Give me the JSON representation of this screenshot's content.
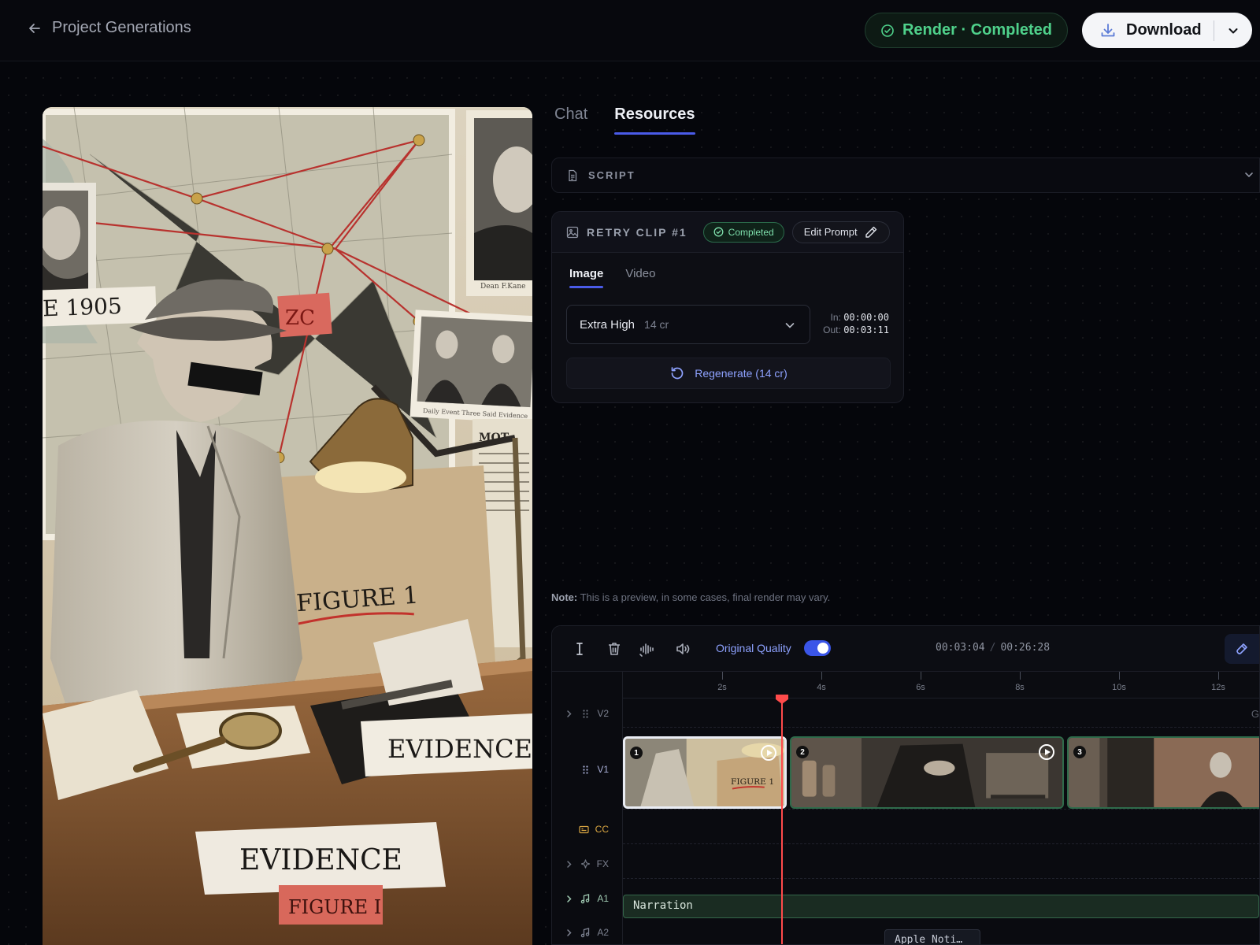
{
  "header": {
    "back_label": "Project Generations",
    "render_status": "Render · Completed",
    "download_label": "Download"
  },
  "preview_text": {
    "year": "E 1905",
    "figure_main": "FIGURE 1",
    "evidence_right": "EVIDENCE",
    "evidence_bottom": "EVIDENCE",
    "figure_bottom": "FIGURE I",
    "news_heading": "MOT",
    "photo_caption": "Dean F.Kane",
    "group_caption": "Daily Event Three Said Evidence",
    "red_tag": "ZC"
  },
  "panel": {
    "tabs": [
      {
        "label": "Chat"
      },
      {
        "label": "Resources"
      }
    ],
    "script_label": "SCRIPT",
    "clip": {
      "title": "RETRY CLIP #1",
      "status": "Completed",
      "edit_label": "Edit Prompt",
      "subtabs": [
        {
          "label": "Image"
        },
        {
          "label": "Video"
        }
      ],
      "quality": "Extra High",
      "quality_credits": "14 cr",
      "in_label": "In:",
      "in_value": "00:00:00",
      "out_label": "Out:",
      "out_value": "00:03:11",
      "regenerate_label": "Regenerate (14 cr)"
    },
    "note_bold": "Note:",
    "note_text": " This is a preview, in some cases, final render may vary."
  },
  "timeline": {
    "original_quality_label": "Original Quality",
    "original_quality_on": true,
    "current_time": "00:03:04",
    "total_time": "00:26:28",
    "ruler_ticks": [
      {
        "label": "2s",
        "seconds": 2
      },
      {
        "label": "4s",
        "seconds": 4
      },
      {
        "label": "6s",
        "seconds": 6
      },
      {
        "label": "8s",
        "seconds": 8
      },
      {
        "label": "10s",
        "seconds": 10
      },
      {
        "label": "12s",
        "seconds": 12
      }
    ],
    "tracks": {
      "v2": "V2",
      "v1": "V1",
      "cc": "CC",
      "fx": "FX",
      "a1": "A1",
      "a2": "A2"
    },
    "clips": [
      {
        "number": "1"
      },
      {
        "number": "2"
      },
      {
        "number": "3"
      }
    ],
    "clip1_text": "FIGURE 1",
    "ghost_label": "G",
    "narration_label": "Narration",
    "apple_label": "Apple Noti…",
    "colors": {
      "accent": "#4a5be8",
      "success": "#4fd18b",
      "playhead": "#ff4b4b",
      "clip_border": "#2f6b4b"
    }
  }
}
